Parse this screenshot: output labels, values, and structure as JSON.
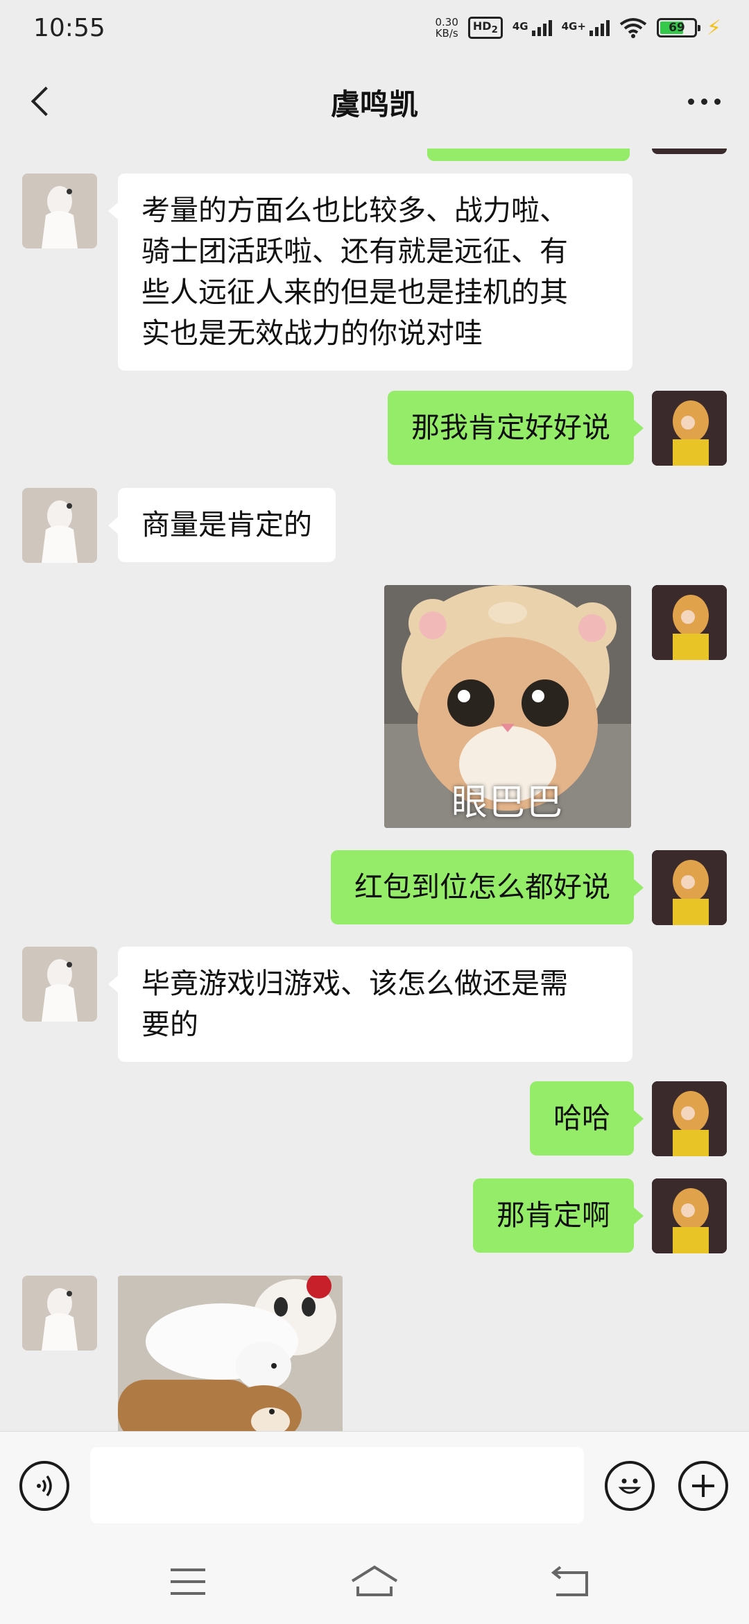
{
  "status_bar": {
    "time": "10:55",
    "net_speed_value": "0.30",
    "net_speed_unit": "KB/s",
    "hd_label": "HD",
    "hd_sub": "2",
    "signal1_label": "4G",
    "signal2_label": "4G+",
    "battery_level": "69"
  },
  "header": {
    "title": "虞鸣凯",
    "back_icon": "chevron-left-icon",
    "more_icon": "more-dots-icon"
  },
  "messages": [
    {
      "sender": "friend",
      "type": "text",
      "text": "考量的方面么也比较多、战力啦、\n骑士团活跃啦、还有就是远征、有\n些人远征人来的但是也是挂机的其\n实也是无效战力的你说对哇"
    },
    {
      "sender": "me",
      "type": "text",
      "text": "那我肯定好好说"
    },
    {
      "sender": "friend",
      "type": "text",
      "text": "商量是肯定的"
    },
    {
      "sender": "me",
      "type": "sticker",
      "caption": "眼巴巴"
    },
    {
      "sender": "me",
      "type": "text",
      "text": "红包到位怎么都好说"
    },
    {
      "sender": "friend",
      "type": "text",
      "text": "毕竟游戏归游戏、该怎么做还是需\n要的"
    },
    {
      "sender": "me",
      "type": "text",
      "text": "哈哈"
    },
    {
      "sender": "me",
      "type": "text",
      "text": "那肯定啊"
    },
    {
      "sender": "friend",
      "type": "image"
    }
  ],
  "input_bar": {
    "voice_icon": "voice-icon",
    "emoji_icon": "emoji-icon",
    "plus_icon": "plus-icon",
    "value": ""
  },
  "system_nav": {
    "menu_icon": "menu-icon",
    "home_icon": "home-icon",
    "back_icon": "back-icon"
  },
  "colors": {
    "background": "#ededed",
    "outgoing_bubble": "#95ec69",
    "incoming_bubble": "#ffffff",
    "battery_fill": "#34c94a"
  }
}
